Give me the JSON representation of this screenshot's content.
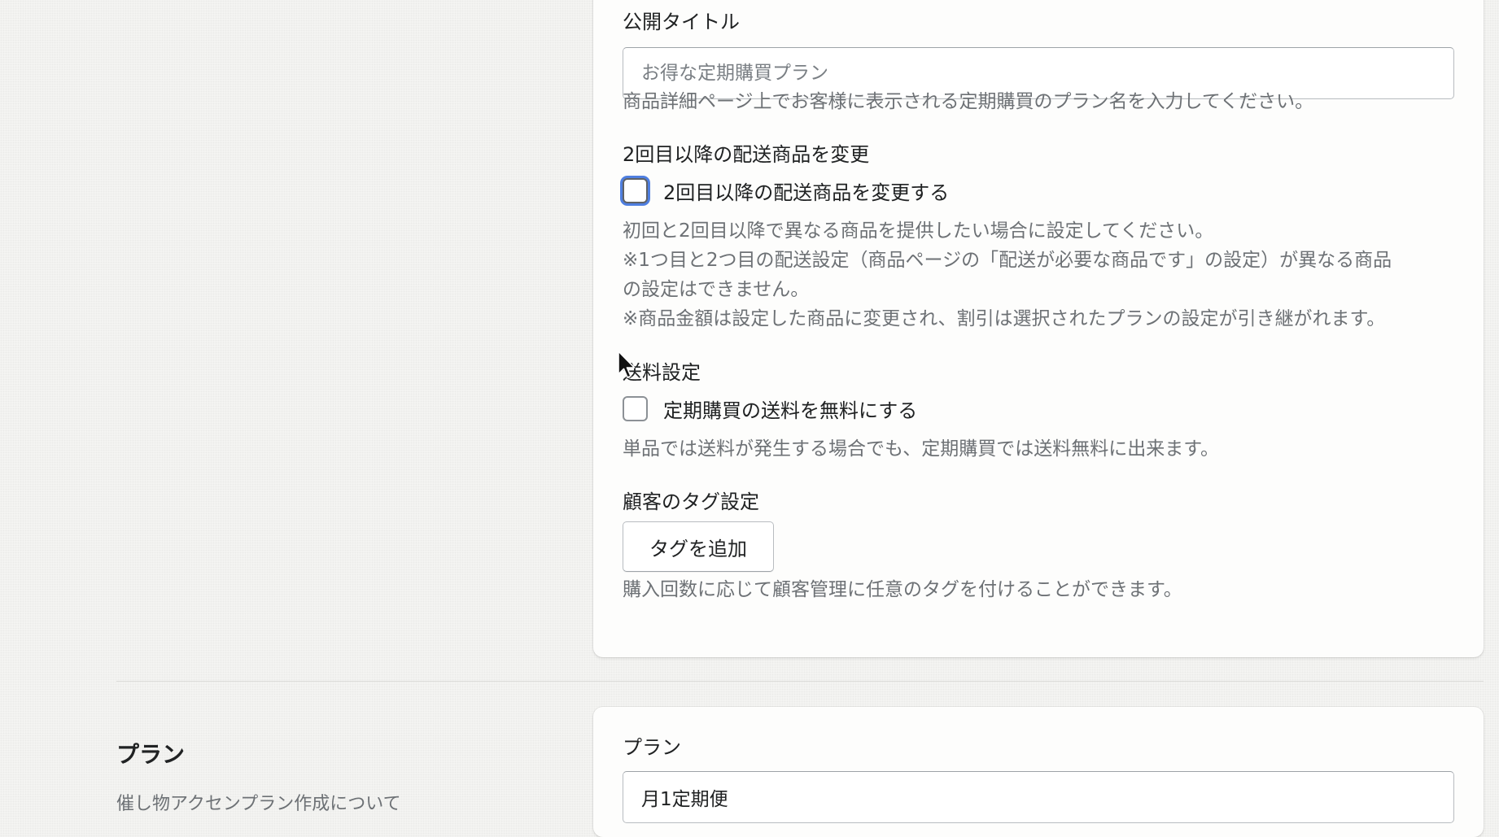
{
  "settings": {
    "title_label": "公開タイトル",
    "title_placeholder": "お得な定期購買プラン",
    "title_help": "商品詳細ページ上でお客様に表示される定期購買のプラン名を入力してください。",
    "change_products": {
      "label": "2回目以降の配送商品を変更",
      "checkbox_label": "2回目以降の配送商品を変更する",
      "checked": false,
      "help_lines": [
        "初回と2回目以降で異なる商品を提供したい場合に設定してください。",
        "※1つ目と2つ目の配送設定（商品ページの「配送が必要な商品です」の設定）が異なる商品",
        "の設定はできません。",
        "※商品金額は設定した商品に変更され、割引は選択されたプランの設定が引き継がれます。"
      ]
    },
    "shipping": {
      "label": "送料設定",
      "checkbox_label": "定期購買の送料を無料にする",
      "checked": false,
      "help": "単品では送料が発生する場合でも、定期購買では送料無料に出来ます。"
    },
    "tags": {
      "label": "顧客のタグ設定",
      "button_label": "タグを追加",
      "help": "購入回数に応じて顧客管理に任意のタグを付けることができます。"
    }
  },
  "plan_section": {
    "heading": "プラン",
    "description": "催し物アクセンプラン作成について",
    "field_label": "プラン",
    "field_value": "月1定期便"
  },
  "icons": {
    "cursor": "mouse-pointer-icon"
  },
  "colors": {
    "focus_ring": "#4f7fe0",
    "help_text": "#6d7175",
    "text": "#202223"
  }
}
